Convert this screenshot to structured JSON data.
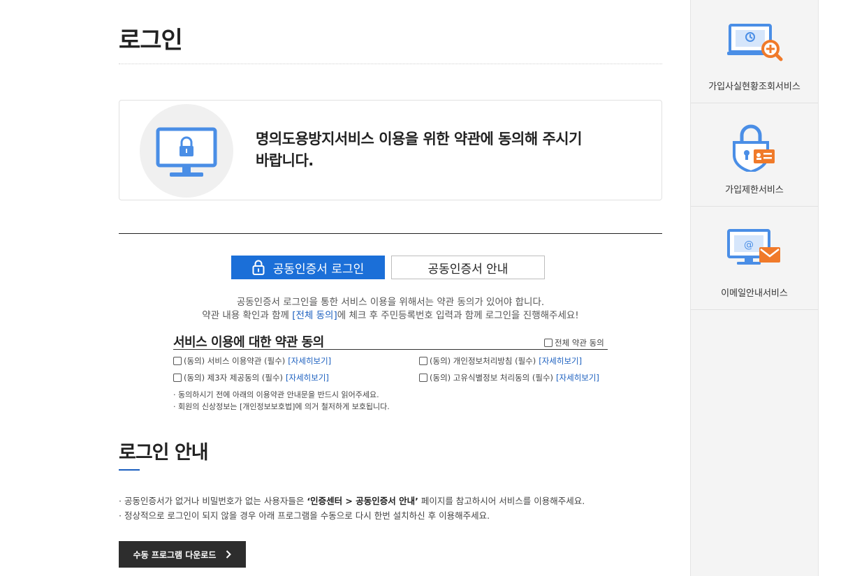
{
  "page": {
    "title": "로그인"
  },
  "notice": {
    "line1": "명의도용방지서비스 이용을 위한 약관에 동의해 주시기",
    "line2": "바랍니다."
  },
  "tabs": [
    {
      "label": "공동인증서 로그인",
      "active": true,
      "icon": "lock-icon"
    },
    {
      "label": "공동인증서 안내",
      "active": false
    }
  ],
  "description": {
    "line1": "공동인증서 로그인을 통한 서비스 이용을 위해서는 약관 동의가 있어야 합니다.",
    "line2_prefix": "약관 내용 확인과 함께 ",
    "line2_highlight": "[전체 동의]",
    "line2_suffix": "에 체크 후 주민등록번호 입력과 함께 로그인을 진행해주세요!"
  },
  "agreement": {
    "title": "서비스 이용에 대한 약관 동의",
    "all_label": "전체 약관 동의",
    "detail_link": "[자세히보기]",
    "items": [
      {
        "label": "(동의) 서비스 이용약관 (필수)",
        "checked": false
      },
      {
        "label": "(동의) 개인정보처리방침 (필수)",
        "checked": false
      },
      {
        "label": "(동의) 제3자 제공동의 (필수)",
        "checked": false
      },
      {
        "label": "(동의) 고유식별정보 처리동의 (필수)",
        "checked": false
      }
    ],
    "notes": [
      "· 동의하시기 전에 아래의 이용약관 안내문을 반드시 읽어주세요.",
      "· 회원의 신상정보는 [개인정보보호법]에 의거 철저하게 보호됩니다."
    ]
  },
  "guide": {
    "title": "로그인 안내",
    "line1_prefix": "· 공동인증서가 없거나 비밀번호가 없는 사용자들은 ",
    "line1_bold": "‘인증센터 > 공동인증서 안내’",
    "line1_suffix": " 페이지를 참고하시어 서비스를 이용해주세요.",
    "line2": "· 정상적으로 로그인이 되지 않을 경우 아래 프로그램을 수동으로 다시 한번 설치하신 후 이용해주세요.",
    "download_label": "수동 프로그램 다운로드"
  },
  "sidebar": {
    "items": [
      {
        "label": "가입사실현황조회서비스",
        "icon": "monitor-search-icon"
      },
      {
        "label": "가입제한서비스",
        "icon": "padlock-id-card-icon"
      },
      {
        "label": "이메일안내서비스",
        "icon": "monitor-email-icon"
      }
    ]
  },
  "colors": {
    "accent": "#1b6fd8",
    "link": "#1b5fbf",
    "icon_blue": "#4a8ee6",
    "icon_orange": "#f07a2a",
    "button_dark": "#2d2d2d",
    "sidebar_bg": "#f4f4f4"
  }
}
